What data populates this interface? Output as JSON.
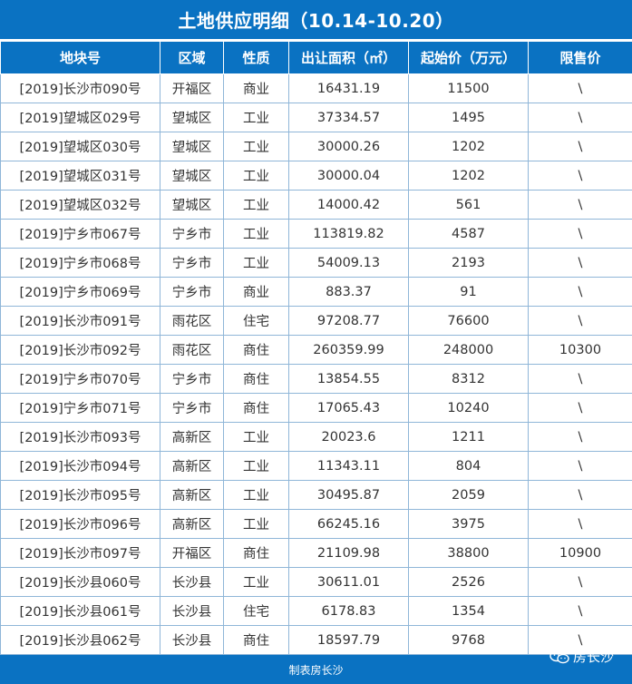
{
  "title": "土地供应明细（10.14-10.20）",
  "headers": [
    "地块号",
    "区域",
    "性质",
    "出让面积（㎡）",
    "起始价（万元）",
    "限售价"
  ],
  "rows": [
    [
      "[2019]长沙市090号",
      "开福区",
      "商业",
      "16431.19",
      "11500",
      "\\"
    ],
    [
      "[2019]望城区029号",
      "望城区",
      "工业",
      "37334.57",
      "1495",
      "\\"
    ],
    [
      "[2019]望城区030号",
      "望城区",
      "工业",
      "30000.26",
      "1202",
      "\\"
    ],
    [
      "[2019]望城区031号",
      "望城区",
      "工业",
      "30000.04",
      "1202",
      "\\"
    ],
    [
      "[2019]望城区032号",
      "望城区",
      "工业",
      "14000.42",
      "561",
      "\\"
    ],
    [
      "[2019]宁乡市067号",
      "宁乡市",
      "工业",
      "113819.82",
      "4587",
      "\\"
    ],
    [
      "[2019]宁乡市068号",
      "宁乡市",
      "工业",
      "54009.13",
      "2193",
      "\\"
    ],
    [
      "[2019]宁乡市069号",
      "宁乡市",
      "商业",
      "883.37",
      "91",
      "\\"
    ],
    [
      "[2019]长沙市091号",
      "雨花区",
      "住宅",
      "97208.77",
      "76600",
      "\\"
    ],
    [
      "[2019]长沙市092号",
      "雨花区",
      "商住",
      "260359.99",
      "248000",
      "10300"
    ],
    [
      "[2019]宁乡市070号",
      "宁乡市",
      "商住",
      "13854.55",
      "8312",
      "\\"
    ],
    [
      "[2019]宁乡市071号",
      "宁乡市",
      "商住",
      "17065.43",
      "10240",
      "\\"
    ],
    [
      "[2019]长沙市093号",
      "高新区",
      "工业",
      "20023.6",
      "1211",
      "\\"
    ],
    [
      "[2019]长沙市094号",
      "高新区",
      "工业",
      "11343.11",
      "804",
      "\\"
    ],
    [
      "[2019]长沙市095号",
      "高新区",
      "工业",
      "30495.87",
      "2059",
      "\\"
    ],
    [
      "[2019]长沙市096号",
      "高新区",
      "工业",
      "66245.16",
      "3975",
      "\\"
    ],
    [
      "[2019]长沙市097号",
      "开福区",
      "商住",
      "21109.98",
      "38800",
      "10900"
    ],
    [
      "[2019]长沙县060号",
      "长沙县",
      "工业",
      "30611.01",
      "2526",
      "\\"
    ],
    [
      "[2019]长沙县061号",
      "长沙县",
      "住宅",
      "6178.83",
      "1354",
      "\\"
    ],
    [
      "[2019]长沙县062号",
      "长沙县",
      "商住",
      "18597.79",
      "9768",
      "\\"
    ]
  ],
  "footer": "制表房长沙",
  "watermark": {
    "text": "房长沙",
    "icon": "wechat-icon"
  },
  "colors": {
    "header": "#0a72c2",
    "border": "#8fb6d8"
  }
}
